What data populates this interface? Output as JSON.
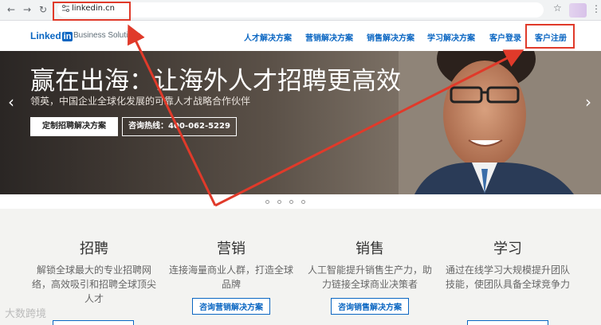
{
  "browser": {
    "url": "linkedin.cn",
    "back_icon": "arrow-left-icon",
    "forward_icon": "arrow-right-icon",
    "reload_icon": "reload-icon"
  },
  "header": {
    "logo_text": "Linked",
    "logo_in": "in",
    "logo_sub": "Business Solutions",
    "nav": [
      {
        "label": "人才解决方案"
      },
      {
        "label": "营销解决方案"
      },
      {
        "label": "销售解决方案"
      },
      {
        "label": "学习解决方案"
      },
      {
        "label": "客户登录"
      },
      {
        "label": "客户注册"
      }
    ]
  },
  "hero": {
    "title": "赢在出海：让海外人才招聘更高效",
    "subtitle": "领英，中国企业全球化发展的可靠人才战略合作伙伴",
    "primary_button": "定制招聘解决方案",
    "secondary_button": "咨询热线：400-062-5229",
    "prev": "‹",
    "next": "›"
  },
  "sections": [
    {
      "title": "招聘",
      "desc": "解锁全球最大的专业招聘网络，高效吸引和招聘全球顶尖人才",
      "button": ""
    },
    {
      "title": "营销",
      "desc": "连接海量商业人群，打造全球品牌",
      "button": "咨询营销解决方案"
    },
    {
      "title": "销售",
      "desc": "人工智能提升销售生产力，助力链接全球商业决策者",
      "button": "咨询销售解决方案"
    },
    {
      "title": "学习",
      "desc": "通过在线学习大规模提升团队技能，使团队具备全球竞争力",
      "button": ""
    }
  ],
  "watermark": "大数跨境",
  "colors": {
    "accent": "#0a66c2",
    "annotation": "#e03a2a"
  }
}
